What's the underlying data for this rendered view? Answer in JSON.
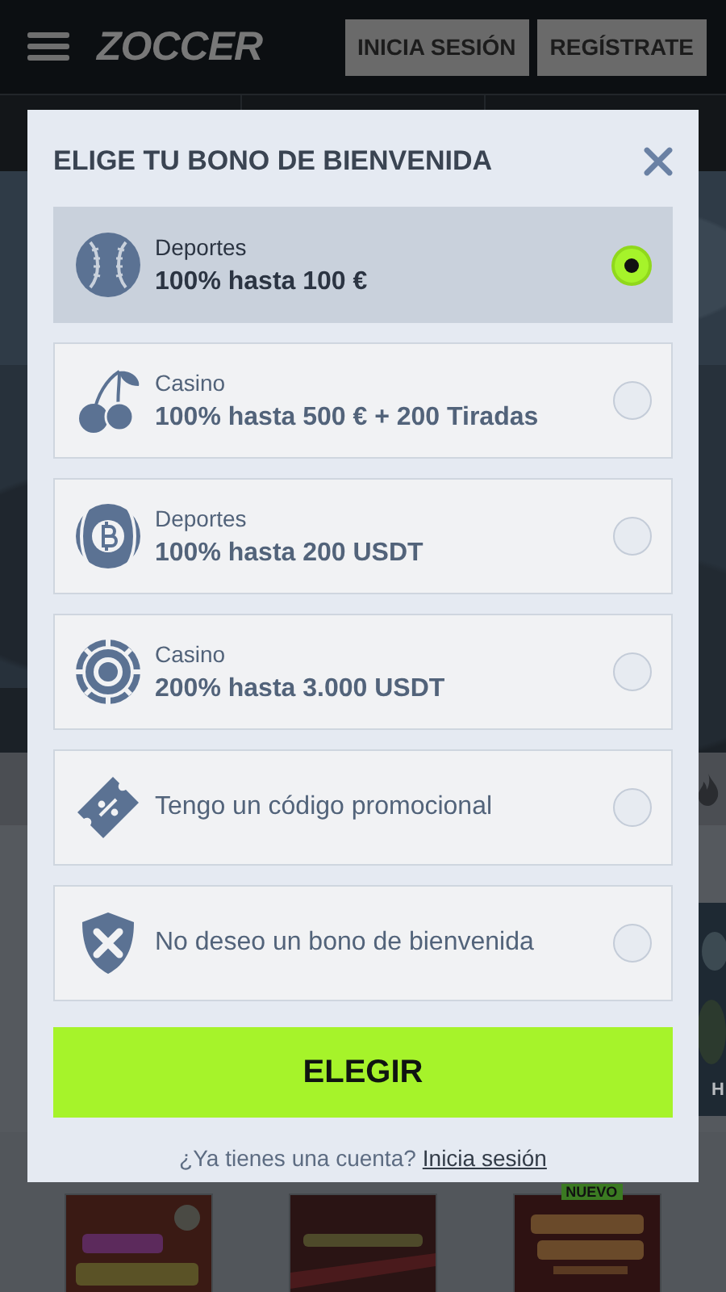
{
  "header": {
    "logo": "ZOCCER",
    "buttons": [
      "INICIA SESIÓN",
      "REGÍSTRATE"
    ]
  },
  "background": {
    "side_text": "H",
    "badge": "NUEVO"
  },
  "modal": {
    "title": "ELIGE TU BONO DE BIENVENIDA",
    "options": [
      {
        "kind": "baseball",
        "category": "Deportes",
        "offer": "100% hasta 100 €",
        "selected": true
      },
      {
        "kind": "cherries",
        "category": "Casino",
        "offer": "100% hasta 500 € + 200 Tiradas",
        "selected": false
      },
      {
        "kind": "coinball",
        "category": "Deportes",
        "offer": "100% hasta 200 USDT",
        "selected": false
      },
      {
        "kind": "chip",
        "category": "Casino",
        "offer": "200% hasta 3.000 USDT",
        "selected": false
      },
      {
        "kind": "ticket",
        "label": "Tengo un código promocional",
        "selected": false
      },
      {
        "kind": "shield",
        "label": "No deseo un bono de bienvenida",
        "selected": false
      }
    ],
    "button": "ELEGIR",
    "footer": {
      "text": "¿Ya tienes una cuenta?",
      "link": "Inicia sesión"
    }
  }
}
